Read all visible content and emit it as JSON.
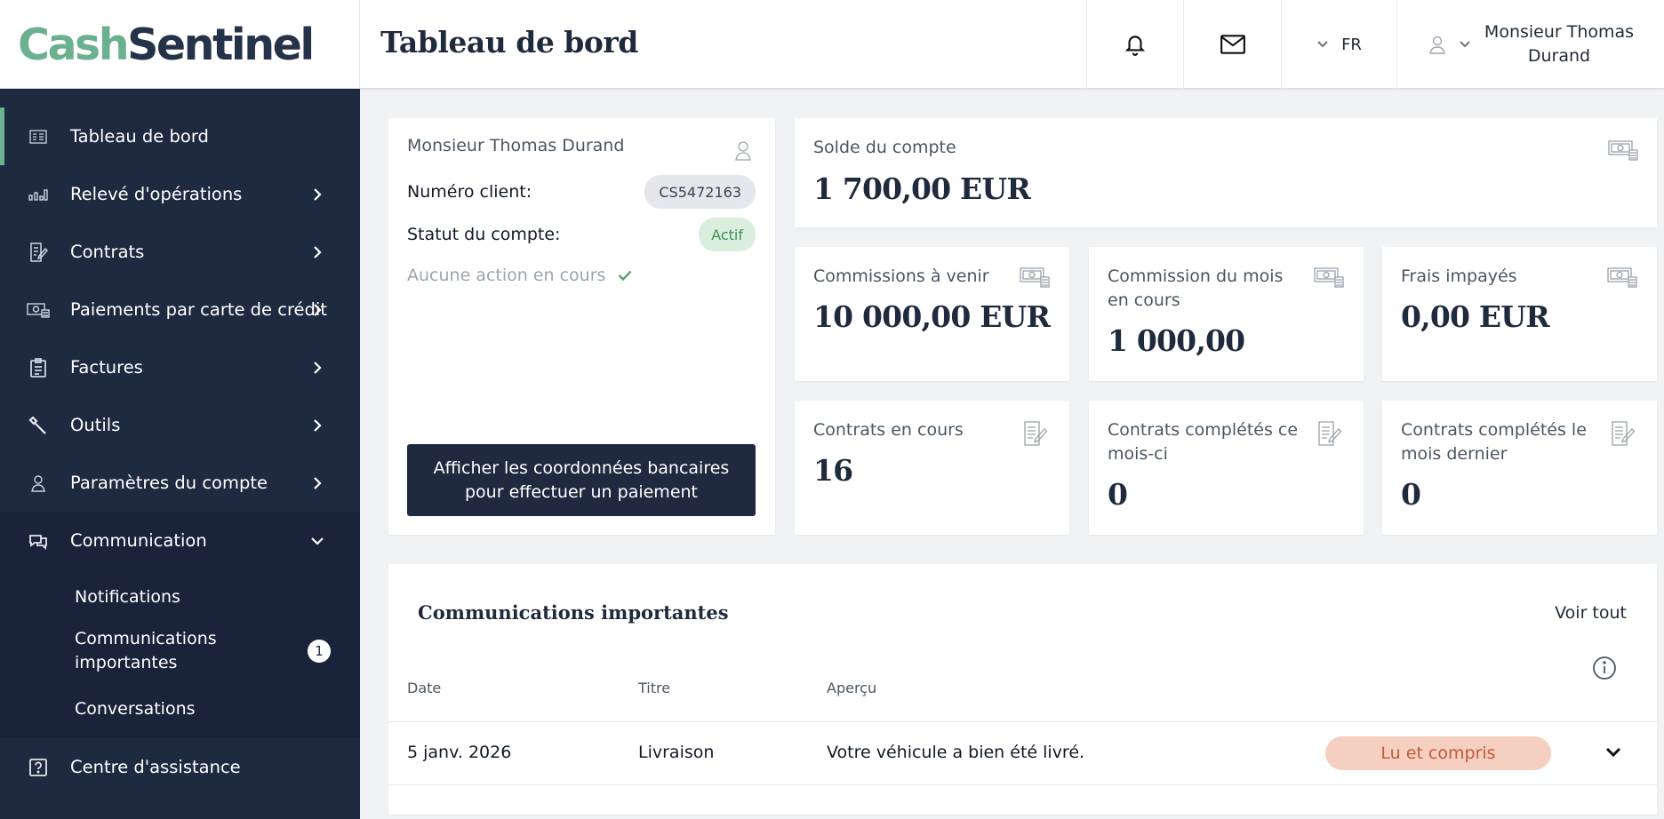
{
  "brand": {
    "part1": "Cash",
    "part2": "Sentinel"
  },
  "header": {
    "page_title": "Tableau de bord",
    "language": "FR",
    "user_name": "Monsieur Thomas Durand"
  },
  "sidebar": {
    "items": [
      {
        "label": "Tableau de bord",
        "icon": "dashboard-icon"
      },
      {
        "label": "Relevé d'opérations",
        "icon": "chart-icon"
      },
      {
        "label": "Contrats",
        "icon": "contract-icon"
      },
      {
        "label": "Paiements par carte de crédit",
        "icon": "credit-card-icon"
      },
      {
        "label": "Factures",
        "icon": "invoice-icon"
      },
      {
        "label": "Outils",
        "icon": "tools-icon"
      },
      {
        "label": "Paramètres du compte",
        "icon": "user-icon"
      },
      {
        "label": "Communication",
        "icon": "chat-icon"
      }
    ],
    "sub_items": [
      {
        "label": "Notifications"
      },
      {
        "label": "Communications importantes",
        "badge": "1"
      },
      {
        "label": "Conversations"
      }
    ],
    "help": {
      "label": "Centre d'assistance",
      "icon": "help-icon"
    }
  },
  "customer": {
    "name": "Monsieur Thomas Durand",
    "client_label": "Numéro client:",
    "client_number": "CS5472163",
    "status_label": "Statut du compte:",
    "status_value": "Actif",
    "note": "Aucune action en cours",
    "pay_button": "Afficher les coordonnées bancaires pour effectuer un paiement"
  },
  "stats": {
    "balance": {
      "title": "Solde du compte",
      "value": "1 700,00 EUR"
    },
    "upcoming": {
      "title": "Commissions à venir",
      "value": "10 000,00 EUR"
    },
    "month_commission": {
      "title": "Commission du mois en cours",
      "value": "1 000,00"
    },
    "unpaid": {
      "title": "Frais impayés",
      "value": "0,00 EUR"
    },
    "contracts_running": {
      "title": "Contrats en cours",
      "value": "16"
    },
    "contracts_month": {
      "title": "Contrats complétés ce mois-ci",
      "value": "0"
    },
    "contracts_last_month": {
      "title": "Contrats complétés le mois dernier",
      "value": "0"
    }
  },
  "communications": {
    "title": "Communications importantes",
    "view_all": "Voir tout",
    "columns": {
      "date": "Date",
      "title": "Titre",
      "preview": "Aperçu"
    },
    "rows": [
      {
        "date": "5 janv. 2026",
        "title": "Livraison",
        "preview": "Votre véhicule a bien été livré.",
        "status": "Lu et compris"
      }
    ]
  },
  "colors": {
    "brand_green": "#6cb18f",
    "navy": "#1e2a40",
    "status_pill_bg": "#f5cfc0",
    "status_pill_text": "#c25a37"
  }
}
